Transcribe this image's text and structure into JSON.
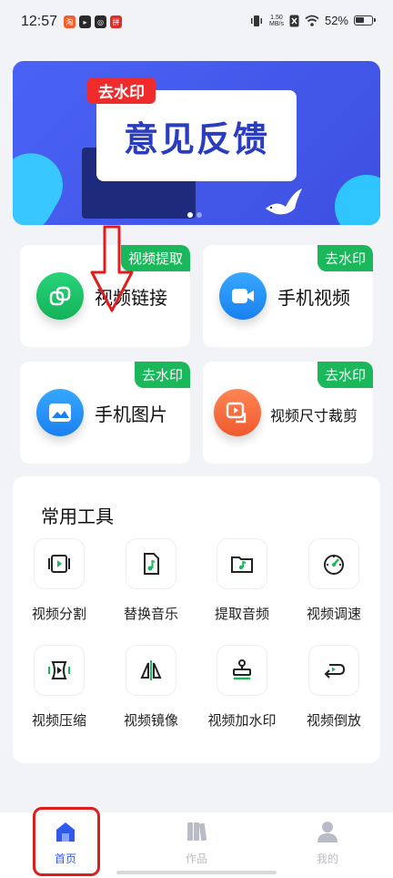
{
  "status_bar": {
    "time": "12:57",
    "speed_value": "1.50",
    "speed_unit": "MB/s",
    "battery": "52%",
    "apps": [
      {
        "label": "淘",
        "color": "#f0612d"
      },
      {
        "label": "▸",
        "color": "#2a2a2a"
      },
      {
        "label": "◎",
        "color": "#2a2a2a"
      },
      {
        "label": "拼",
        "color": "#e12a2a"
      }
    ]
  },
  "banner": {
    "tag": "去水印",
    "title": "意见反馈",
    "page_count": 2,
    "active_page": 1
  },
  "features": [
    {
      "label": "视频链接",
      "badge": "视频提取",
      "icon": "link-icon",
      "color": "#1cc56a"
    },
    {
      "label": "手机视频",
      "badge": "去水印",
      "icon": "video-camera-icon",
      "color": "#1a90f5"
    },
    {
      "label": "手机图片",
      "badge": "去水印",
      "icon": "image-icon",
      "color": "#1a90f5"
    },
    {
      "label": "视频尺寸裁剪",
      "badge": "去水印",
      "icon": "crop-video-icon",
      "color": "#f46a3f"
    }
  ],
  "tools": {
    "title": "常用工具",
    "items": [
      {
        "label": "视频分割",
        "icon": "split-video-icon"
      },
      {
        "label": "替换音乐",
        "icon": "replace-music-icon"
      },
      {
        "label": "提取音频",
        "icon": "extract-audio-icon"
      },
      {
        "label": "视频调速",
        "icon": "speed-icon"
      },
      {
        "label": "视频压缩",
        "icon": "compress-video-icon"
      },
      {
        "label": "视频镜像",
        "icon": "mirror-icon"
      },
      {
        "label": "视频加水印",
        "icon": "stamp-icon"
      },
      {
        "label": "视频倒放",
        "icon": "reverse-icon"
      }
    ]
  },
  "tabbar": {
    "tabs": [
      {
        "label": "首页",
        "icon": "home-icon",
        "active": true
      },
      {
        "label": "作品",
        "icon": "works-icon",
        "active": false
      },
      {
        "label": "我的",
        "icon": "profile-icon",
        "active": false
      }
    ],
    "active_color": "#2f5bea",
    "inactive_color": "#b8bcc6"
  },
  "annotations": {
    "highlight_color": "#e01c1c"
  }
}
